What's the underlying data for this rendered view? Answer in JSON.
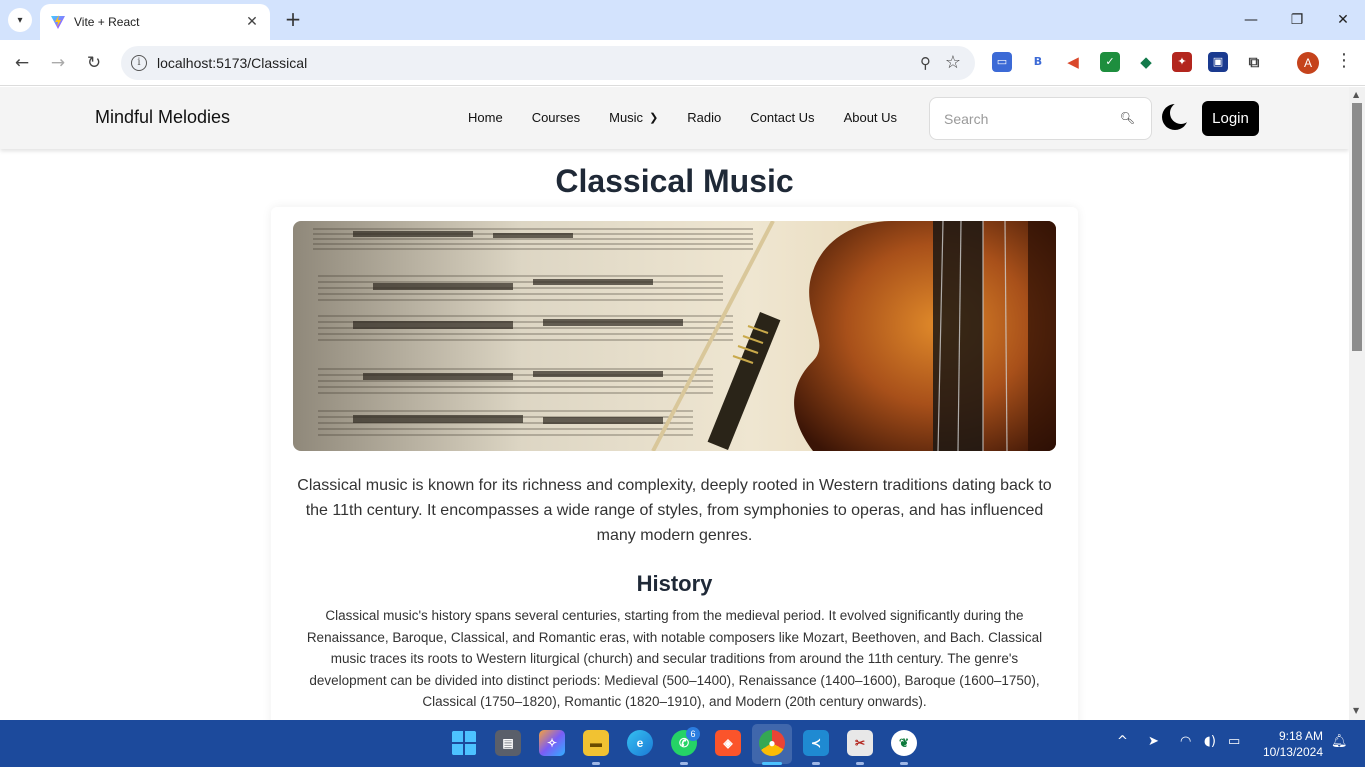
{
  "browser": {
    "tab_title": "Vite + React",
    "url": "localhost:5173/Classical"
  },
  "site": {
    "brand": "Mindful Melodies",
    "nav": [
      {
        "label": "Home"
      },
      {
        "label": "Courses"
      },
      {
        "label": "Music"
      },
      {
        "label": "Radio"
      },
      {
        "label": "Contact Us"
      },
      {
        "label": "About Us"
      }
    ],
    "search_placeholder": "Search",
    "login_label": "Login"
  },
  "content": {
    "title": "Classical Music",
    "intro": "Classical music is known for its richness and complexity, deeply rooted in Western traditions dating back to the 11th century. It encompasses a wide range of styles, from symphonies to operas, and has influenced many modern genres.",
    "history_title": "History",
    "history_text": "Classical music's history spans several centuries, starting from the medieval period. It evolved significantly during the Renaissance, Baroque, Classical, and Romantic eras, with notable composers like Mozart, Beethoven, and Bach. Classical music traces its roots to Western liturgical (church) and secular traditions from around the 11th century. The genre's development can be divided into distinct periods: Medieval (500–1400), Renaissance (1400–1600), Baroque (1600–1750), Classical (1750–1820), Romantic (1820–1910), and Modern (20th century onwards)."
  },
  "taskbar": {
    "whatsapp_badge": "6",
    "time": "9:18 AM",
    "date": "10/13/2024"
  },
  "profile_initial": "A",
  "colors": {
    "tabbar": "#d3e3fd",
    "taskbar": "#1c4a9c",
    "login_bg": "#000000",
    "nav_bg": "#f4f4f4"
  }
}
